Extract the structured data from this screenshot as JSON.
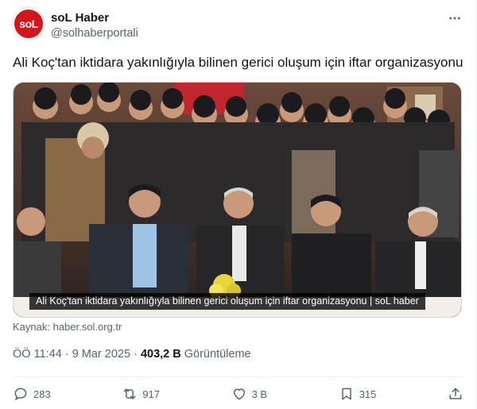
{
  "author": {
    "avatar_text": "soL",
    "display_name": "soL Haber",
    "handle": "@solhaberportali"
  },
  "tweet": {
    "text": "Ali Koç'tan iktidara yakınlığıyla bilinen gerici oluşum için iftar organizasyonu",
    "media_caption": "Ali Koç'tan iktidara yakınlığıyla bilinen gerici oluşum için iftar organizasyonu | soL haber",
    "source_text": "Kaynak: haber.sol.org.tr",
    "time": "ÖÖ 11:44",
    "separator": " · ",
    "date": "9 Mar 2025",
    "views_count": "403,2 B",
    "views_label": "Görüntüleme"
  },
  "actions": {
    "replies": "283",
    "reposts": "917",
    "likes": "3 B",
    "bookmarks": "315"
  },
  "icons": [
    "more-icon",
    "reply-icon",
    "repost-icon",
    "like-icon",
    "bookmark-icon",
    "share-icon"
  ],
  "colors": {
    "brand_red": "#d8141b",
    "text_primary": "#0f1419",
    "text_secondary": "#536471",
    "border": "#cfd9de"
  }
}
